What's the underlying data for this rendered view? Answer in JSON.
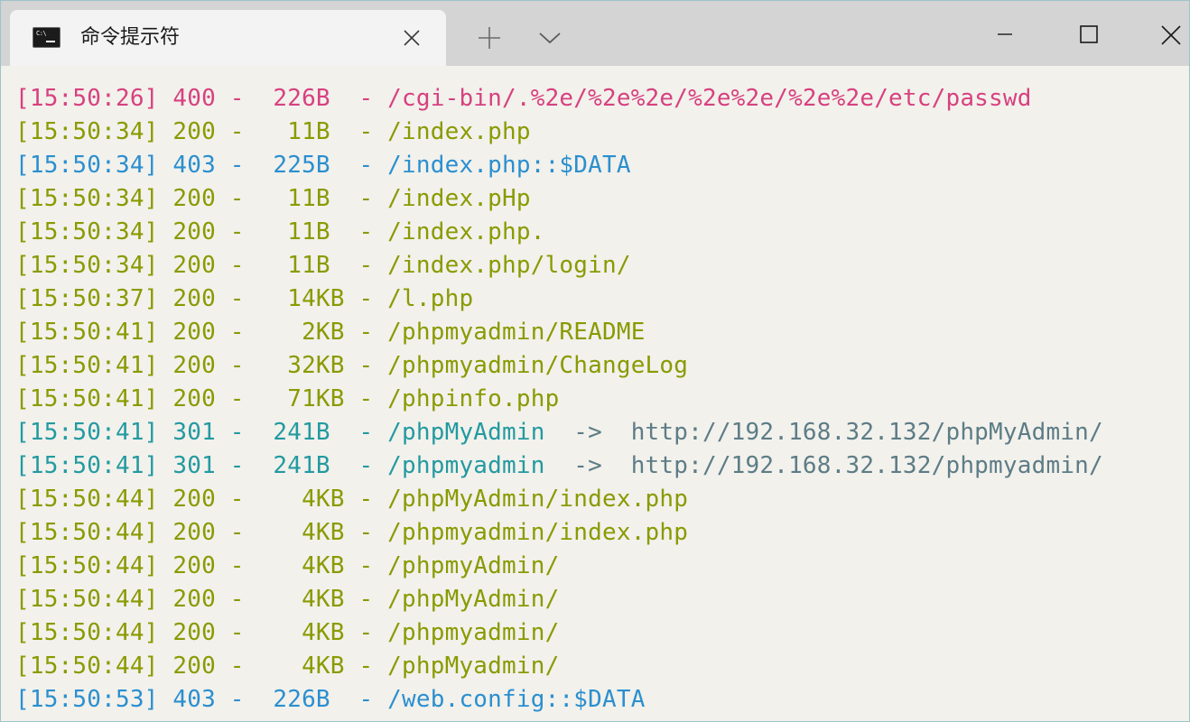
{
  "window": {
    "tab_title": "命令提示符",
    "icon_prompt_text": "C:\\",
    "colors": {
      "titlebar": "#d4d4d4",
      "tab": "#f3f3f3",
      "background": "#f2f1ec"
    }
  },
  "controls": {
    "tab_close_icon": "close-icon",
    "new_tab_icon": "plus-icon",
    "dropdown_icon": "chevron-down-icon",
    "minimize_icon": "minimize-icon",
    "maximize_icon": "maximize-icon",
    "close_icon": "close-icon"
  },
  "terminal": {
    "colors": {
      "pink": "#d7417f",
      "olive": "#8a9a00",
      "blue": "#2b8fcf",
      "teal": "#239aa0",
      "gray": "#5d7c86"
    },
    "lines": [
      {
        "color": "pink",
        "text": "[15:50:26] 400 -  226B  - /cgi-bin/.%2e/%2e%2e/%2e%2e/%2e%2e/etc/passwd",
        "redirect": ""
      },
      {
        "color": "olive",
        "text": "[15:50:34] 200 -   11B  - /index.php",
        "redirect": ""
      },
      {
        "color": "blue",
        "text": "[15:50:34] 403 -  225B  - /index.php::$DATA",
        "redirect": ""
      },
      {
        "color": "olive",
        "text": "[15:50:34] 200 -   11B  - /index.pHp",
        "redirect": ""
      },
      {
        "color": "olive",
        "text": "[15:50:34] 200 -   11B  - /index.php.",
        "redirect": ""
      },
      {
        "color": "olive",
        "text": "[15:50:34] 200 -   11B  - /index.php/login/",
        "redirect": ""
      },
      {
        "color": "olive",
        "text": "[15:50:37] 200 -   14KB - /l.php",
        "redirect": ""
      },
      {
        "color": "olive",
        "text": "[15:50:41] 200 -    2KB - /phpmyadmin/README",
        "redirect": ""
      },
      {
        "color": "olive",
        "text": "[15:50:41] 200 -   32KB - /phpmyadmin/ChangeLog",
        "redirect": ""
      },
      {
        "color": "olive",
        "text": "[15:50:41] 200 -   71KB - /phpinfo.php",
        "redirect": ""
      },
      {
        "color": "teal",
        "text": "[15:50:41] 301 -  241B  - /phpMyAdmin  ",
        "redirect": "->  http://192.168.32.132/phpMyAdmin/"
      },
      {
        "color": "teal",
        "text": "[15:50:41] 301 -  241B  - /phpmyadmin  ",
        "redirect": "->  http://192.168.32.132/phpmyadmin/"
      },
      {
        "color": "olive",
        "text": "[15:50:44] 200 -    4KB - /phpMyAdmin/index.php",
        "redirect": ""
      },
      {
        "color": "olive",
        "text": "[15:50:44] 200 -    4KB - /phpmyadmin/index.php",
        "redirect": ""
      },
      {
        "color": "olive",
        "text": "[15:50:44] 200 -    4KB - /phpmyAdmin/",
        "redirect": ""
      },
      {
        "color": "olive",
        "text": "[15:50:44] 200 -    4KB - /phpMyAdmin/",
        "redirect": ""
      },
      {
        "color": "olive",
        "text": "[15:50:44] 200 -    4KB - /phpmyadmin/",
        "redirect": ""
      },
      {
        "color": "olive",
        "text": "[15:50:44] 200 -    4KB - /phpMyadmin/",
        "redirect": ""
      },
      {
        "color": "blue",
        "text": "[15:50:53] 403 -  226B  - /web.config::$DATA",
        "redirect": ""
      }
    ]
  }
}
